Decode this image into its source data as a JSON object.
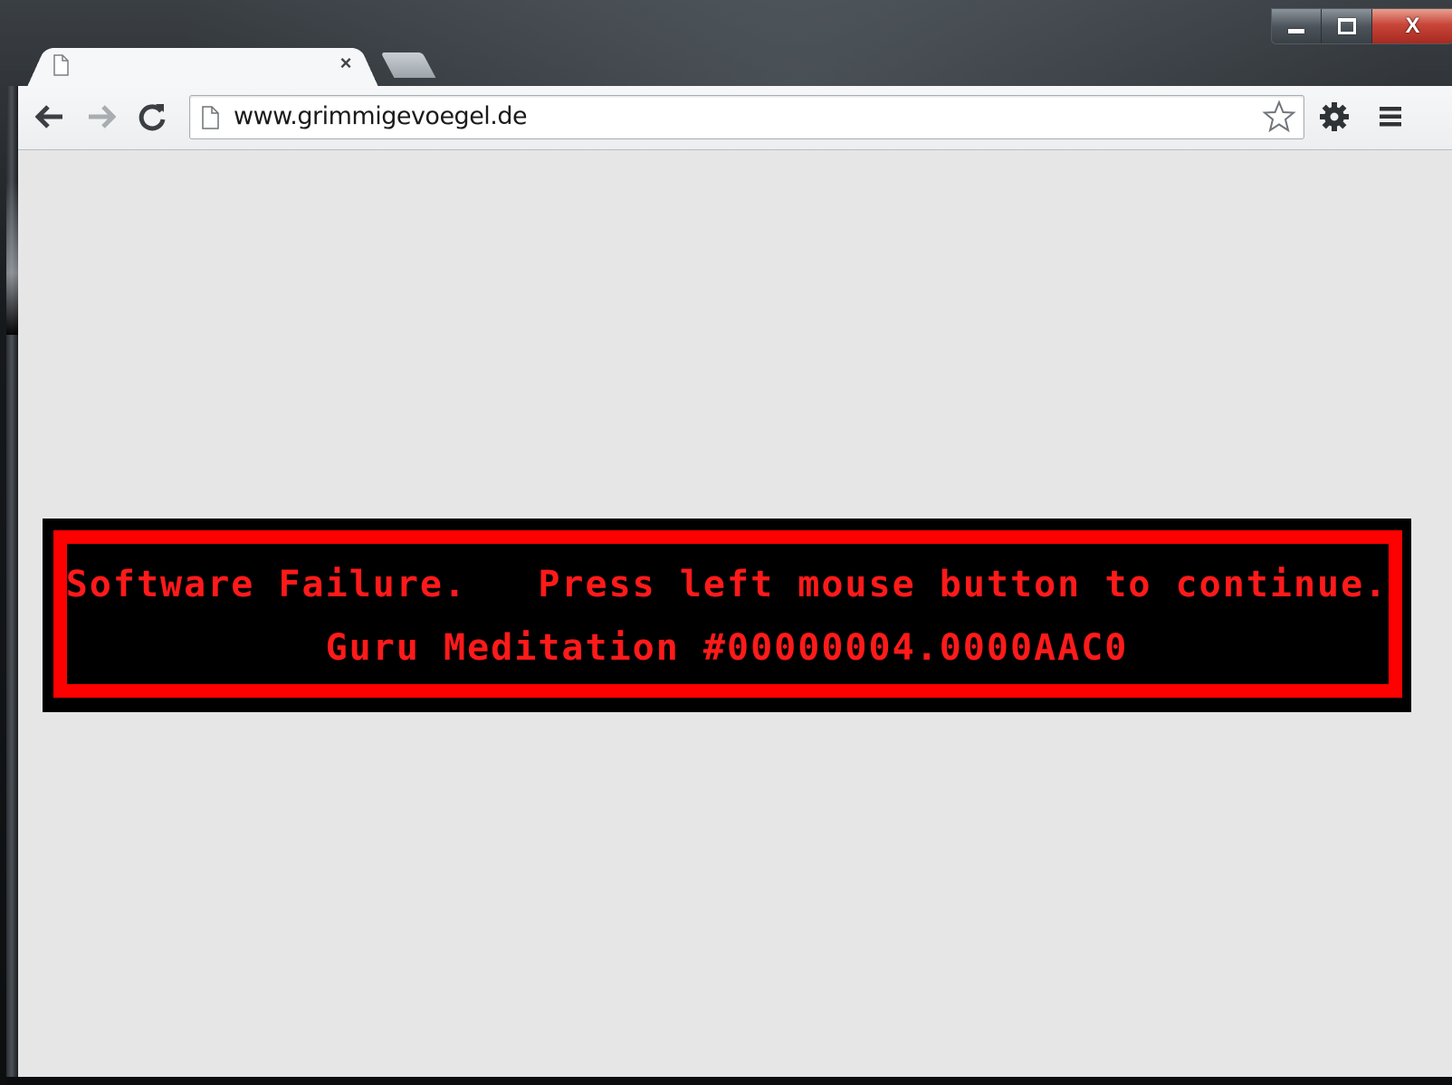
{
  "window": {
    "controls": {
      "minimize_icon": "minimize-icon",
      "maximize_icon": "maximize-icon",
      "close_label": "X"
    }
  },
  "tab": {
    "title": "",
    "close_label": "×",
    "icon": "page-icon"
  },
  "toolbar": {
    "back_icon": "back-arrow-icon",
    "forward_icon": "forward-arrow-icon",
    "reload_icon": "reload-icon",
    "url": "www.grimmigevoegel.de",
    "bookmark_icon": "star-icon",
    "settings_icon": "gear-icon",
    "menu_icon": "hamburger-menu-icon"
  },
  "page": {
    "background": "#e6e6e6",
    "guru": {
      "line1": "Software Failure.   Press left mouse button to continue.",
      "line2": "Guru Meditation #00000004.0000AAC0",
      "color": "#ff0000",
      "background": "#000000"
    }
  }
}
